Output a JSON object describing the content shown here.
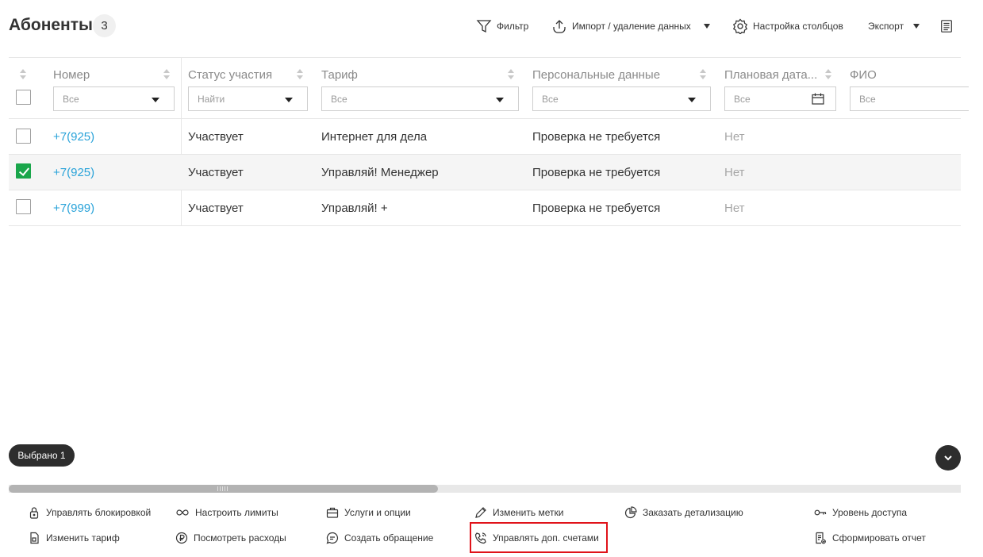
{
  "header": {
    "title": "Абоненты",
    "count": "3"
  },
  "toolbar": {
    "filter_label": "Фильтр",
    "import_label": "Импорт / удаление данных",
    "columns_label": "Настройка столбцов",
    "export_label": "Экспорт"
  },
  "table": {
    "columns": [
      "Номер",
      "Статус участия",
      "Тариф",
      "Персональные данные",
      "Плановая дата...",
      "ФИО"
    ],
    "filters": {
      "number": "Все",
      "status": "Найти",
      "tariff": "Все",
      "personal": "Все",
      "date": "Все",
      "fio": "Все"
    },
    "rows": [
      {
        "number": "+7(925)",
        "status": "Участвует",
        "tariff": "Интернет для дела",
        "personal": "Проверка не требуется",
        "date": "Нет",
        "checked": false
      },
      {
        "number": "+7(925)",
        "status": "Участвует",
        "tariff": "Управляй! Менеджер",
        "personal": "Проверка не требуется",
        "date": "Нет",
        "checked": true
      },
      {
        "number": "+7(999)",
        "status": "Участвует",
        "tariff": "Управляй! +",
        "personal": "Проверка не требуется",
        "date": "Нет",
        "checked": false
      }
    ]
  },
  "selection": {
    "label": "Выбрано 1"
  },
  "actions": {
    "manage_block": "Управлять блокировкой",
    "set_limits": "Настроить лимиты",
    "services": "Услуги и опции",
    "edit_tags": "Изменить метки",
    "order_details": "Заказать детализацию",
    "access_level": "Уровень доступа",
    "change_tariff": "Изменить тариф",
    "view_expenses": "Посмотреть расходы",
    "create_request": "Создать обращение",
    "manage_accounts": "Управлять доп. счетами",
    "make_report": "Сформировать отчет"
  },
  "colors": {
    "accent_link": "#2aa3d9",
    "checkbox_checked": "#1aa64b",
    "dark_pill": "#2d2d2d",
    "highlight": "#e0131a"
  }
}
